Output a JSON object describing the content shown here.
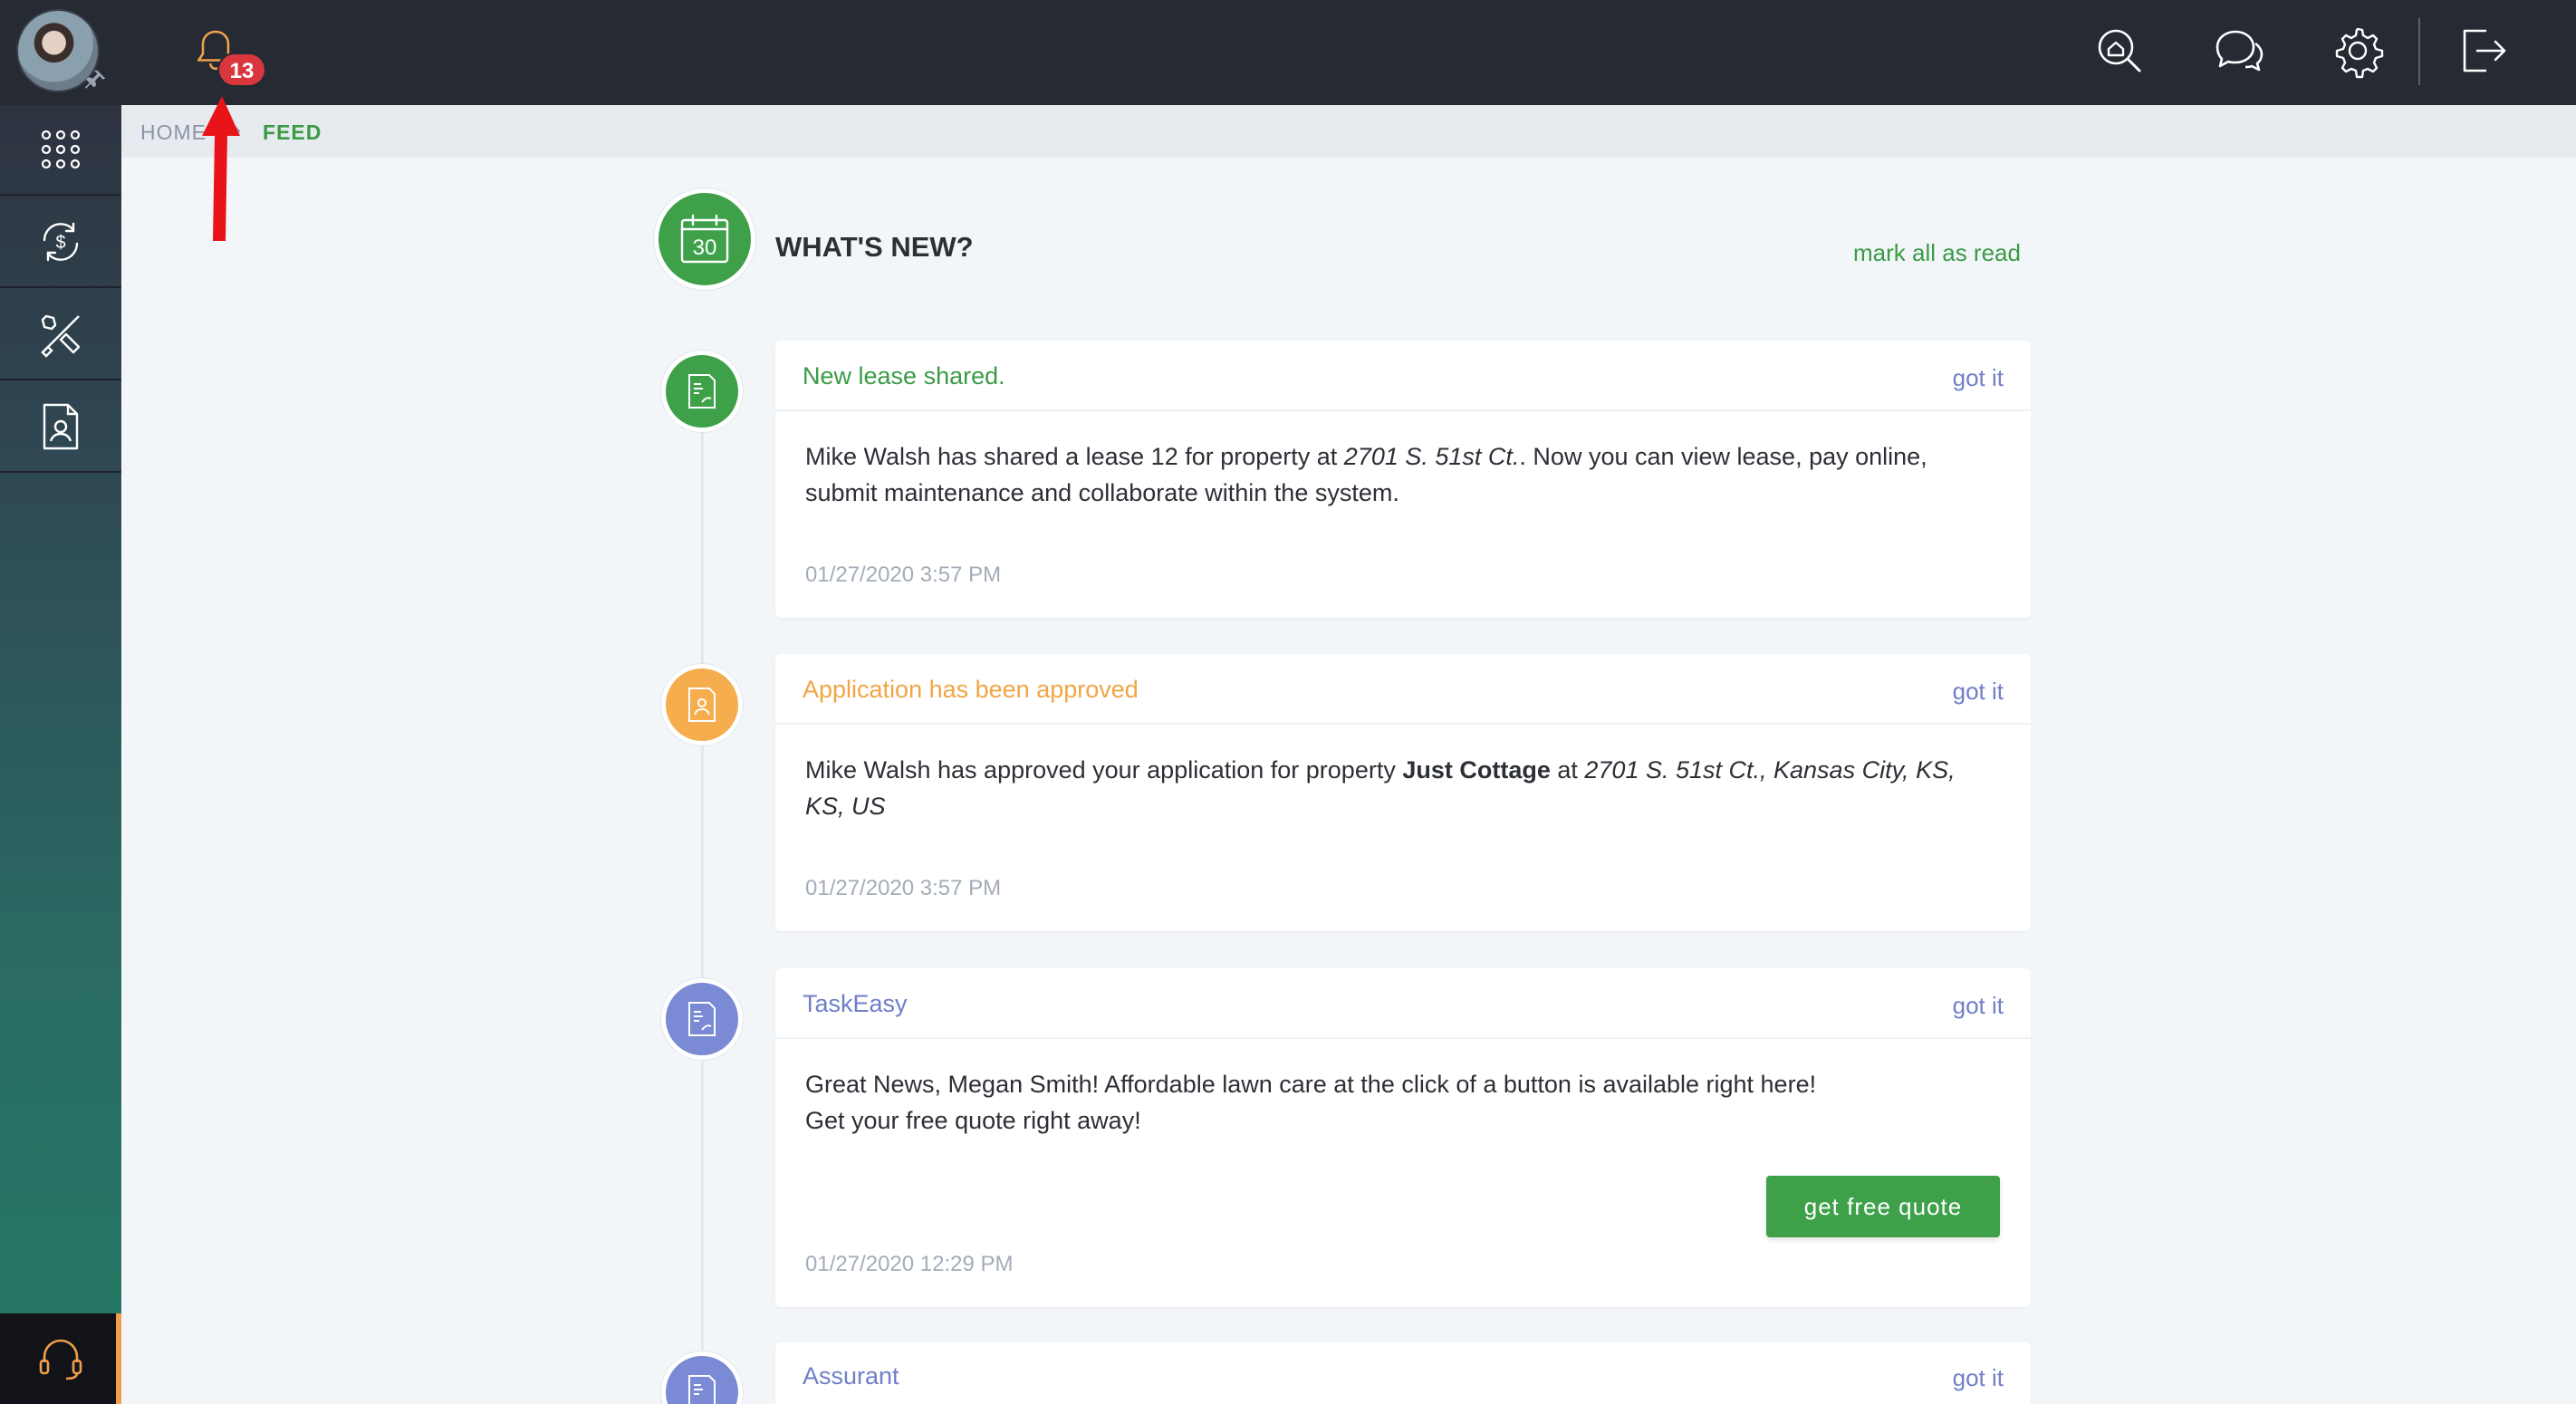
{
  "topbar": {
    "notifications_count": "13",
    "icons": [
      "search-home-icon",
      "chat-icon",
      "gear-icon",
      "logout-icon"
    ]
  },
  "sidebar": {
    "items": [
      "apps-grid-icon",
      "payments-icon",
      "maintenance-tools-icon",
      "tenant-document-icon"
    ],
    "support": "headset-icon"
  },
  "breadcrumb": {
    "home": "HOME",
    "separator": "›",
    "current": "FEED"
  },
  "feed": {
    "title": "WHAT'S NEW?",
    "calendar_day": "30",
    "mark_all_read": "mark all as read",
    "items": [
      {
        "title": "New lease shared.",
        "title_color": "#3a9b45",
        "dot_color": "#3ea14a",
        "action": "got it",
        "body_part1": "Mike Walsh has shared a lease 12 for property at ",
        "body_italic": "2701 S. 51st Ct.",
        "body_part2": ". Now you can view lease, pay online, submit maintenance and collaborate within the system.",
        "date": "01/27/2020 3:57 PM"
      },
      {
        "title": "Application has been approved",
        "title_color": "#f0a644",
        "dot_color": "#f5ad4e",
        "action": "got it",
        "body_part1": "Mike Walsh has approved your application for property ",
        "body_bold": "Just Cottage",
        "body_part2": " at ",
        "body_italic": "2701 S. 51st Ct., Kansas City, KS, KS, US",
        "date": "01/27/2020 3:57 PM"
      },
      {
        "title": "TaskEasy",
        "title_color": "#6f7fc8",
        "dot_color": "#7b8ad4",
        "action": "got it",
        "body_line1": "Great News, Megan Smith! Affordable lawn care at the click of a button is available right here!",
        "body_line2": "Get your free quote right away!",
        "button": "get free quote",
        "date": "01/27/2020 12:29 PM"
      },
      {
        "title": "Assurant",
        "title_color": "#6f7fc8",
        "dot_color": "#7b8ad4",
        "action": "got it"
      }
    ]
  },
  "colors": {
    "accent_green": "#3ea14a",
    "badge_red": "#d9363e",
    "link_blue": "#6f7fc8",
    "topbar": "#262a33"
  }
}
